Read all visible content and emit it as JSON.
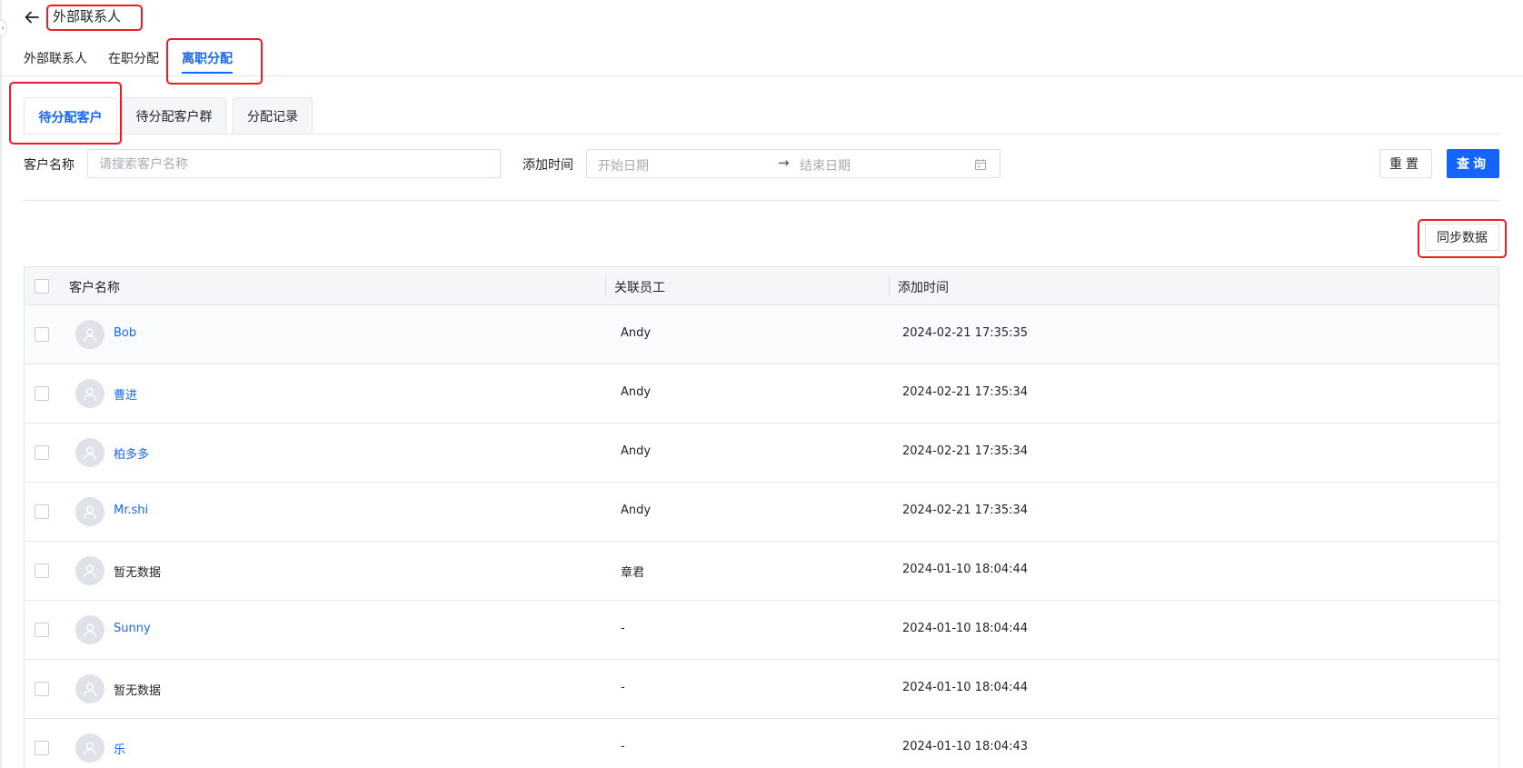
{
  "header": {
    "title": "外部联系人"
  },
  "top_tabs": [
    {
      "label": "外部联系人",
      "active": false
    },
    {
      "label": "在职分配",
      "active": false
    },
    {
      "label": "离职分配",
      "active": true
    }
  ],
  "sub_tabs": [
    {
      "label": "待分配客户",
      "active": true
    },
    {
      "label": "待分配客户群",
      "active": false
    },
    {
      "label": "分配记录",
      "active": false
    }
  ],
  "filters": {
    "customer_name_label": "客户名称",
    "customer_name_placeholder": "请搜索客户名称",
    "added_time_label": "添加时间",
    "start_date_placeholder": "开始日期",
    "range_separator": "→",
    "end_date_placeholder": "结束日期"
  },
  "buttons": {
    "reset": "重置",
    "query": "查询",
    "sync": "同步数据"
  },
  "table": {
    "columns": [
      "客户名称",
      "关联员工",
      "添加时间"
    ],
    "rows": [
      {
        "name": "Bob",
        "name_is_link": true,
        "employee": "Andy",
        "added_time": "2024-02-21 17:35:35"
      },
      {
        "name": "曹进",
        "name_is_link": true,
        "employee": "Andy",
        "added_time": "2024-02-21 17:35:34"
      },
      {
        "name": "柏多多",
        "name_is_link": true,
        "employee": "Andy",
        "added_time": "2024-02-21 17:35:34"
      },
      {
        "name": "Mr.shi",
        "name_is_link": true,
        "employee": "Andy",
        "added_time": "2024-02-21 17:35:34"
      },
      {
        "name": "暂无数据",
        "name_is_link": false,
        "employee": "章君",
        "added_time": "2024-01-10 18:04:44"
      },
      {
        "name": "Sunny",
        "name_is_link": true,
        "employee": "-",
        "added_time": "2024-01-10 18:04:44"
      },
      {
        "name": "暂无数据",
        "name_is_link": false,
        "employee": "-",
        "added_time": "2024-01-10 18:04:44"
      },
      {
        "name": "乐",
        "name_is_link": true,
        "employee": "-",
        "added_time": "2024-01-10 18:04:43"
      }
    ]
  },
  "icons": {
    "back": "arrow-left-icon",
    "collapse": "chevron-left-icon",
    "calendar": "calendar-icon",
    "avatar": "user-icon"
  },
  "colors": {
    "accent": "#1664ff",
    "annotation": "#ee1c25",
    "header_bg": "#f5f6f7",
    "border": "#e5e6eb"
  }
}
